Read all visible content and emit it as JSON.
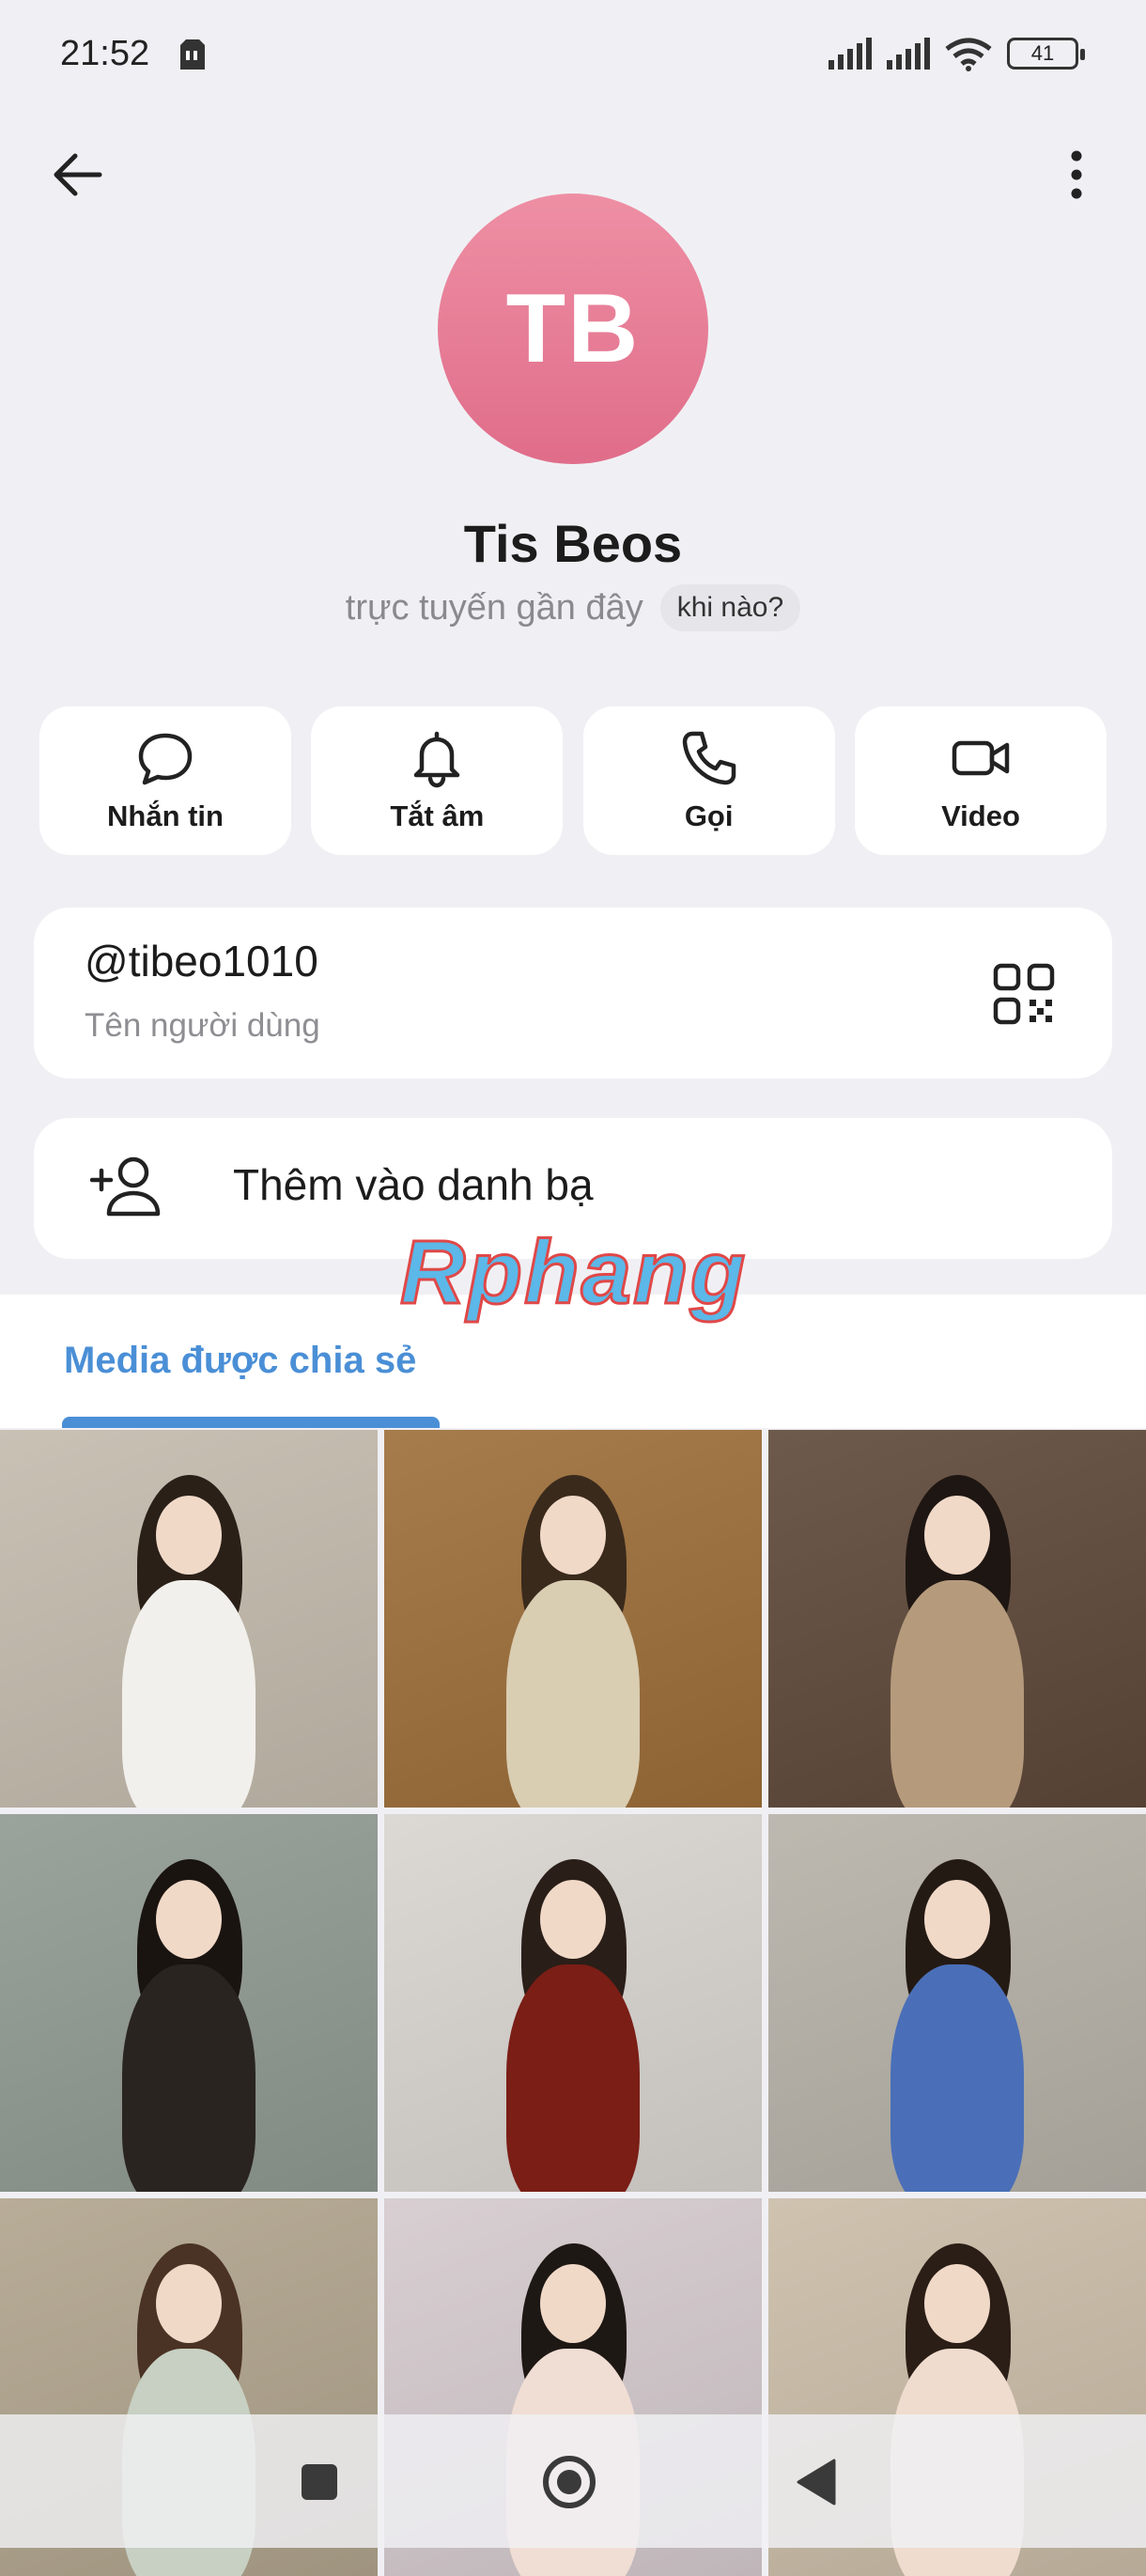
{
  "status_bar": {
    "time": "21:52",
    "battery": "41"
  },
  "profile": {
    "initials": "TB",
    "name": "Tis Beos",
    "last_seen": "trực tuyến gần đây",
    "when_chip": "khi nào?",
    "avatar_color_top": "#ee8fa4",
    "avatar_color_bottom": "#e06d8a"
  },
  "actions": [
    {
      "label": "Nhắn tin",
      "icon": "message-icon"
    },
    {
      "label": "Tắt âm",
      "icon": "bell-icon"
    },
    {
      "label": "Gọi",
      "icon": "phone-icon"
    },
    {
      "label": "Video",
      "icon": "video-icon"
    }
  ],
  "username_card": {
    "username": "@tibeo1010",
    "caption": "Tên người dùng"
  },
  "add_contact": {
    "label": "Thêm vào danh bạ"
  },
  "watermark": "Rphang",
  "media": {
    "tab_label": "Media được chia sẻ",
    "accent": "#4a8fd6",
    "photos": [
      {
        "name": "photo-cafe-counter",
        "bg": "#c9c1b4",
        "fig": "#f2f0ec",
        "hair": "#2a2018"
      },
      {
        "name": "photo-wooden-door",
        "bg": "#a67c4c",
        "fig": "#d9cdb2",
        "hair": "#3a2a1c"
      },
      {
        "name": "photo-trench-coat",
        "bg": "#6e5a4c",
        "fig": "#b59a7c",
        "hair": "#1e1612"
      },
      {
        "name": "photo-lace-dress",
        "bg": "#9aa39c",
        "fig": "#2a2420",
        "hair": "#1a1410"
      },
      {
        "name": "photo-red-sweater",
        "bg": "#dcd8d4",
        "fig": "#7a1e16",
        "hair": "#2a1e18"
      },
      {
        "name": "photo-blue-bodysuit",
        "bg": "#bdb9b0",
        "fig": "#4a6fb8",
        "hair": "#241a14"
      },
      {
        "name": "photo-window-portrait",
        "bg": "#b8ad98",
        "fig": "#c7d0c2",
        "hair": "#4a3224"
      },
      {
        "name": "photo-mirror-selfie",
        "bg": "#d8cfd2",
        "fig": "#f0ddd4",
        "hair": "#1e1814"
      },
      {
        "name": "photo-curtain-selfie",
        "bg": "#cfc3b0",
        "fig": "#efdccf",
        "hair": "#2a1e16"
      }
    ]
  }
}
